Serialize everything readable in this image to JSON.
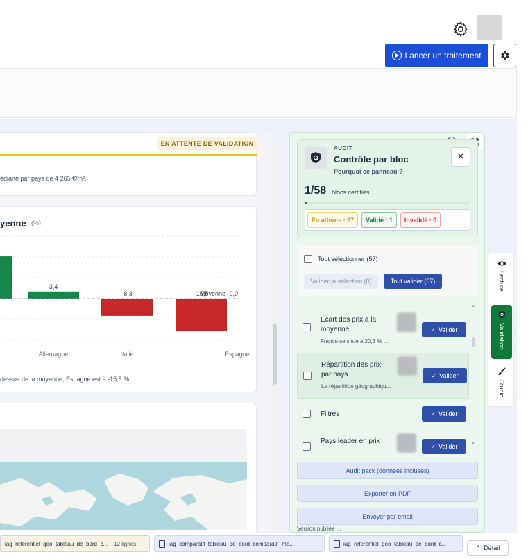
{
  "header": {
    "launch_label": "Lancer un traitement"
  },
  "card1": {
    "badge": "EN ATTENTE DE VALIDATION",
    "text": "édiane par pays de 4 265 €/m²."
  },
  "card2": {
    "title": "yenne",
    "unit": "(%)",
    "caption": "dessus de la moyenne; Espagne est à -15,5 %."
  },
  "chart_data": {
    "type": "bar",
    "categories": [
      "",
      "Allemagne",
      "Italie",
      "Espagne"
    ],
    "values": [
      20.3,
      3.4,
      -8.3,
      -15.5
    ],
    "data_labels": [
      "",
      "3,4",
      "-8,3",
      "-15,5"
    ],
    "reference_line_label": "Moyenne -0,0",
    "colors": {
      "positive": "#16864a",
      "negative": "#c62828"
    },
    "ylim": [
      -20,
      30
    ]
  },
  "panel": {
    "kicker": "AUDIT",
    "title": "Contrôle par bloc",
    "why": "Pourquoi ce panneau ?",
    "close": "×",
    "progress": "1/58",
    "progress_label": "blocs certifiés",
    "progress_fraction": 0.017,
    "chips": {
      "waiting": "En attente · 57",
      "valid": "Validé · 1",
      "invalid": "Invalidé · 0"
    },
    "select_all": "Tout sélectionner (57)",
    "validate_selection": "Valider la sélection (0)",
    "validate_all": "Tout valider (57)",
    "items": [
      {
        "title": "Écart des prix à la moyenne",
        "sub": "France se situe à 20,3 % ...",
        "button": "Valider"
      },
      {
        "title": "Répartition des prix par pays",
        "sub": "La répartition géographiqu...",
        "button": "Valider"
      },
      {
        "title": "Filtres",
        "sub": "",
        "button": "Valider"
      },
      {
        "title": "Pays leader en prix",
        "sub": "",
        "button": "Valider"
      }
    ],
    "actions": {
      "audit_pack": "Audit pack (données incluses)",
      "export_pdf": "Exporter en PDF",
      "send_email": "Envoyer par email"
    },
    "footnote": "Version publiée ..."
  },
  "side_tabs": {
    "reading": "Lecture",
    "validation": "Validation",
    "studio": "Studio"
  },
  "bottom_bar": {
    "tab1": "iag_referentiel_geo_tableau_de_bord_c...",
    "tab1_count": "12 lignes",
    "tab2": "iag_comparatif_tableau_de_bord_comparatif_ma...",
    "tab3": "iag_referentiel_geo_tableau_de_bord_c...",
    "detail": "Détail"
  }
}
